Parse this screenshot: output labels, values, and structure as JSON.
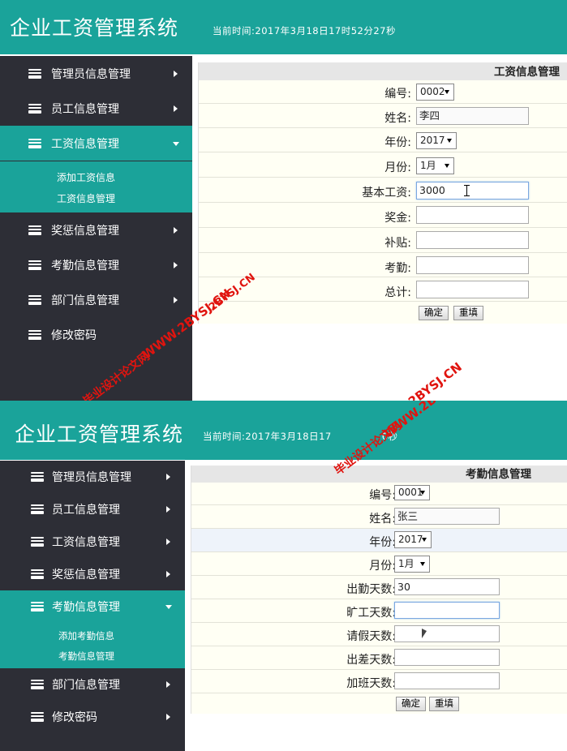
{
  "screens": [
    {
      "app_title": "企业工资管理系统",
      "time_label": "当前时间:2017年3月18日17时52分27秒",
      "nav": [
        {
          "label": "管理员信息管理"
        },
        {
          "label": "员工信息管理"
        },
        {
          "label": "工资信息管理",
          "active": true
        },
        {
          "label": "奖惩信息管理"
        },
        {
          "label": "考勤信息管理"
        },
        {
          "label": "部门信息管理"
        },
        {
          "label": "修改密码"
        }
      ],
      "submenu": [
        "添加工资信息",
        "工资信息管理"
      ],
      "panel_title": "工资信息管理",
      "form": {
        "id_label": "编号:",
        "id_value": "0002",
        "name_label": "姓名:",
        "name_value": "李四",
        "year_label": "年份:",
        "year_value": "2017",
        "month_label": "月份:",
        "month_value": "1月",
        "base_label": "基本工资:",
        "base_value": "3000",
        "bonus_label": "奖金:",
        "bonus_value": "",
        "allowance_label": "补贴:",
        "allowance_value": "",
        "attendance_label": "考勤:",
        "attendance_value": "",
        "total_label": "总计:",
        "total_value": ""
      },
      "buttons": {
        "confirm": "确定",
        "reset": "重填"
      }
    },
    {
      "app_title": "企业工资管理系统",
      "time_label": "当前时间:2017年3月18日17",
      "time_label_tail": "6秒",
      "nav": [
        {
          "label": "管理员信息管理"
        },
        {
          "label": "员工信息管理"
        },
        {
          "label": "工资信息管理"
        },
        {
          "label": "奖惩信息管理"
        },
        {
          "label": "考勤信息管理",
          "active": true
        },
        {
          "label": "部门信息管理"
        },
        {
          "label": "修改密码"
        }
      ],
      "submenu": [
        "添加考勤信息",
        "考勤信息管理"
      ],
      "panel_title": "考勤信息管理",
      "form": {
        "id_label": "编号:",
        "id_value": "0001",
        "name_label": "姓名:",
        "name_value": "张三",
        "year_label": "年份:",
        "year_value": "2017",
        "month_label": "月份:",
        "month_value": "1月",
        "present_label": "出勤天数:",
        "present_value": "30",
        "absent_label": "旷工天数:",
        "absent_value": "",
        "leave_label": "请假天数:",
        "leave_value": "",
        "trip_label": "出差天数:",
        "trip_value": "",
        "overtime_label": "加班天数:",
        "overtime_value": ""
      },
      "buttons": {
        "confirm": "确定",
        "reset": "重填"
      }
    }
  ],
  "watermarks": {
    "site_cn": "毕业设计论文网",
    "site_url_www": "WWW.2BYSJ.CN",
    "site_url_short": "2BYSJ.CN"
  },
  "colors": {
    "accent": "#1aa39a",
    "sidebar": "#2d2e36",
    "content_bg": "#fffff4",
    "watermark": "#e0140f"
  },
  "icons": {
    "nav_icon": "stack-icon",
    "nav_arrow": "chevron-right-icon",
    "nav_arrow_open": "caret-down-icon",
    "select_caret": "caret-down-icon"
  }
}
